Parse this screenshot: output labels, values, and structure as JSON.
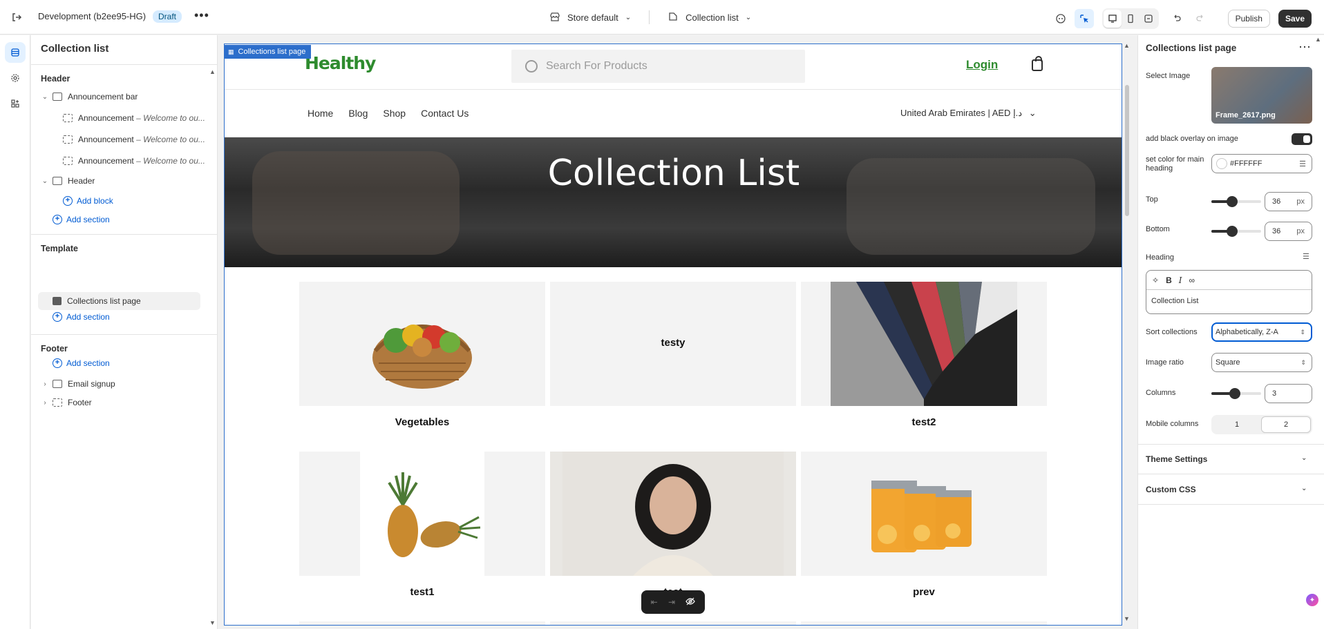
{
  "topbar": {
    "title": "Development (b2ee95-HG)",
    "badge": "Draft",
    "more": "•••",
    "store": "Store default",
    "template": "Collection list",
    "publish": "Publish",
    "save": "Save"
  },
  "left": {
    "title": "Collection list",
    "header_group": "Header",
    "announcement_bar": "Announcement bar",
    "announcements": [
      {
        "label": "Announcement",
        "detail": "– Welcome to ou..."
      },
      {
        "label": "Announcement",
        "detail": "– Welcome to ou..."
      },
      {
        "label": "Announcement",
        "detail": "– Welcome to ou..."
      }
    ],
    "header_section": "Header",
    "add_block": "Add block",
    "add_section": "Add section",
    "template_group": "Template",
    "collections_list_page": "Collections list page",
    "footer_group": "Footer",
    "email_signup": "Email signup",
    "footer_section": "Footer"
  },
  "canvas": {
    "frame_tag": "Collections list page",
    "logo": "Healthy",
    "search_placeholder": "Search For Products",
    "login": "Login",
    "nav": [
      "Home",
      "Blog",
      "Shop",
      "Contact Us"
    ],
    "region": "United Arab Emirates | AED د.إ",
    "hero_title": "Collection List",
    "cards": [
      {
        "label": "Vegetables"
      },
      {
        "label": "",
        "center": "testy"
      },
      {
        "label": "test2"
      },
      {
        "label": "test1"
      },
      {
        "label": "test"
      },
      {
        "label": "prev"
      }
    ]
  },
  "right": {
    "title": "Collections list page",
    "select_image": "Select Image",
    "image_name": "Frame_2617.png",
    "overlay_label": "add black overlay on image",
    "color_label": "set color for main heading",
    "color_value": "#FFFFFF",
    "top_label": "Top",
    "top_value": "36",
    "bottom_label": "Bottom",
    "bottom_value": "36",
    "unit": "px",
    "heading_label": "Heading",
    "heading_value": "Collection List",
    "sort_label": "Sort collections",
    "sort_value": "Alphabetically, Z-A",
    "ratio_label": "Image ratio",
    "ratio_value": "Square",
    "columns_label": "Columns",
    "columns_value": "3",
    "mobile_label": "Mobile columns",
    "mobile_options": [
      "1",
      "2"
    ],
    "theme_settings": "Theme Settings",
    "custom_css": "Custom CSS"
  },
  "colors": {
    "accent": "#005bd3",
    "brand_green": "#2e8b2e",
    "frame_blue": "#2c6ecb"
  }
}
